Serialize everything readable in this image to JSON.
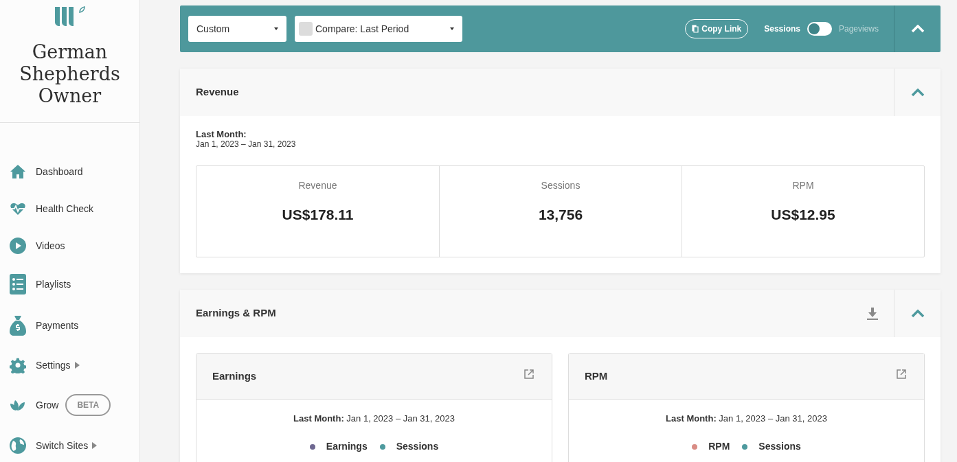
{
  "brand": {
    "name": "German Shepherds Owner"
  },
  "sidebar": {
    "items": [
      {
        "label": "Dashboard",
        "submenu": false
      },
      {
        "label": "Health Check",
        "submenu": false
      },
      {
        "label": "Videos",
        "submenu": false
      },
      {
        "label": "Playlists",
        "submenu": false
      },
      {
        "label": "Payments",
        "submenu": false
      },
      {
        "label": "Settings",
        "submenu": true
      },
      {
        "label": "Grow",
        "submenu": false,
        "badge": "BETA"
      },
      {
        "label": "Switch Sites",
        "submenu": true
      }
    ]
  },
  "toolbar": {
    "range": {
      "value": "Custom"
    },
    "compare": {
      "label": "Compare: Last Period",
      "checked": false
    },
    "copy_link": "Copy Link",
    "metric_toggle": {
      "on": false,
      "options": [
        "Sessions",
        "Pageviews"
      ]
    }
  },
  "revenue": {
    "title": "Revenue",
    "period_label": "Last Month:",
    "period": "Jan 1, 2023 – Jan 31, 2023",
    "expanded": true,
    "stats": [
      {
        "label": "Revenue",
        "value": "US$178.11"
      },
      {
        "label": "Sessions",
        "value": "13,756"
      },
      {
        "label": "RPM",
        "value": "US$12.95"
      }
    ]
  },
  "earnings_rpm": {
    "title": "Earnings & RPM",
    "expanded": true,
    "cards": [
      {
        "title": "Earnings",
        "period_label": "Last Month:",
        "period": "Jan 1, 2023 – Jan 31, 2023",
        "legend": [
          {
            "label": "Earnings",
            "color": "#6e6891"
          },
          {
            "label": "Sessions",
            "color": "#4e9a9e"
          }
        ]
      },
      {
        "title": "RPM",
        "period_label": "Last Month:",
        "period": "Jan 1, 2023 – Jan 31, 2023",
        "legend": [
          {
            "label": "RPM",
            "color": "#d98c85"
          },
          {
            "label": "Sessions",
            "color": "#4e9a9e"
          }
        ]
      }
    ]
  }
}
